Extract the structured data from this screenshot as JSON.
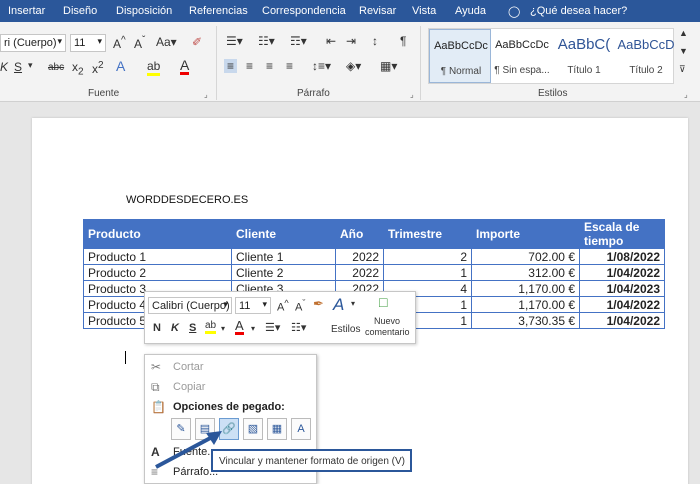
{
  "menu": [
    "Insertar",
    "Diseño",
    "Disposición",
    "Referencias",
    "Correspondencia",
    "Revisar",
    "Vista",
    "Ayuda"
  ],
  "tell_me": "¿Qué desea hacer?",
  "ribbon": {
    "font_name": "ri (Cuerpo)",
    "font_size": "11",
    "group_font": "Fuente",
    "group_paragraph": "Párrafo",
    "group_styles": "Estilos",
    "styles": [
      {
        "preview": "AaBbCcDc",
        "name": "¶ Normal"
      },
      {
        "preview": "AaBbCcDc",
        "name": "¶ Sin espa..."
      },
      {
        "preview": "AaBbC(",
        "name": "Título 1"
      },
      {
        "preview": "AaBbCcD",
        "name": "Título 2"
      }
    ]
  },
  "doc": {
    "heading": "WORDDESDECERO.ES",
    "table": {
      "headers": [
        "Producto",
        "Cliente",
        "Año",
        "Trimestre",
        "Importe",
        "Escala de tiempo"
      ],
      "rows": [
        [
          "Producto 1",
          "Cliente 1",
          "2022",
          "2",
          "702.00 €",
          "1/08/2022"
        ],
        [
          "Producto 2",
          "Cliente 2",
          "2022",
          "1",
          "312.00 €",
          "1/04/2022"
        ],
        [
          "Producto 3",
          "Cliente 3",
          "2022",
          "4",
          "1,170.00 €",
          "1/04/2023"
        ],
        [
          "Producto 4",
          "",
          "",
          "1",
          "1,170.00 €",
          "1/04/2022"
        ],
        [
          "Producto 5",
          "",
          "",
          "1",
          "3,730.35 €",
          "1/04/2022"
        ]
      ]
    }
  },
  "mini_toolbar": {
    "font_name": "Calibri (Cuerpo)",
    "font_size": "11",
    "styles_label": "Estilos",
    "new_comment_line1": "Nuevo",
    "new_comment_line2": "comentario"
  },
  "context_menu": {
    "cut": "Cortar",
    "copy": "Copiar",
    "paste_options": "Opciones de pegado:",
    "font": "Fuente...",
    "paragraph": "Párrafo..."
  },
  "tooltip": "Vincular y mantener formato de origen (V)",
  "colors": {
    "accent": "#2b579a",
    "table_header": "#4472c4"
  }
}
